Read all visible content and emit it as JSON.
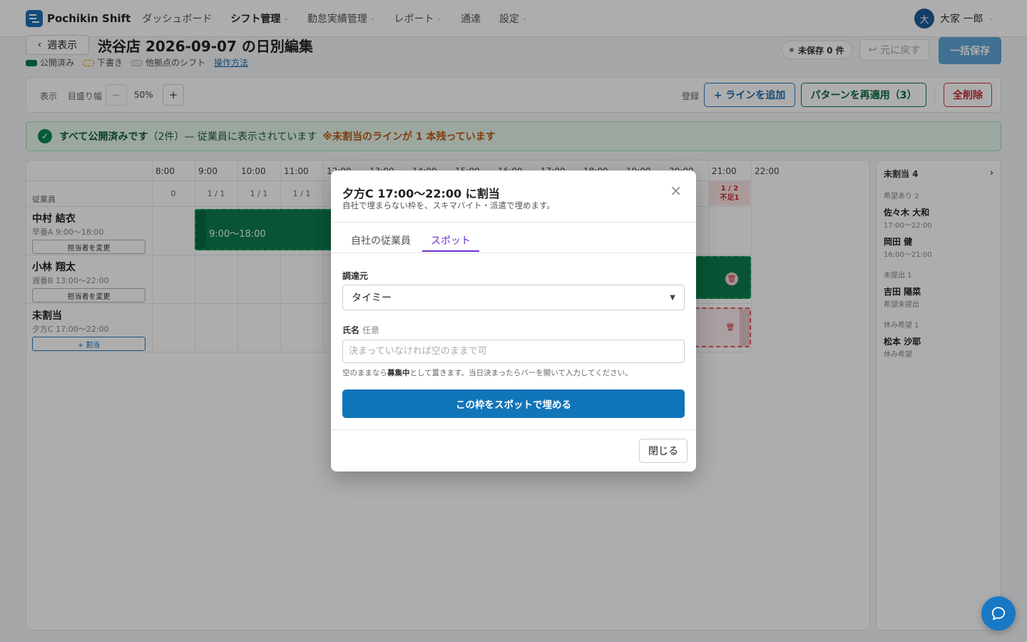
{
  "app": {
    "name": "Pochikin Shift"
  },
  "nav": {
    "items": [
      {
        "label": "ダッシュボード"
      },
      {
        "label": "シフト管理"
      },
      {
        "label": "勤怠実績管理"
      },
      {
        "label": "レポート"
      },
      {
        "label": "通達"
      },
      {
        "label": "設定"
      }
    ],
    "user": {
      "initial": "大",
      "name": "大家 一郎"
    }
  },
  "header": {
    "back_label": "週表示",
    "title": "渋谷店 2026-09-07 の日別編集",
    "legend": {
      "published": "公開済み",
      "draft": "下書き",
      "other_site": "他拠点のシフト",
      "help_link": "操作方法"
    },
    "unsaved": "未保存 0 件",
    "undo": "元に戻す",
    "save_all": "一括保存"
  },
  "toolbar": {
    "display_label": "表示",
    "scale_label": "目盛り幅",
    "minus": "−",
    "zoom": "50%",
    "plus": "+",
    "register_label": "登録",
    "add_line": "+ ラインを追加",
    "reapply": "パターンを再適用（3）",
    "delete_all": "全削除"
  },
  "banner": {
    "main": "すべて公開済みです",
    "count": "（2件）— 従業員に表示されています",
    "warning": "※未割当のラインが 1 本残っています"
  },
  "grid": {
    "column_header": "従業員",
    "hours": [
      "8:00",
      "9:00",
      "10:00",
      "11:00",
      "12:00",
      "13:00",
      "14:00",
      "15:00",
      "16:00",
      "17:00",
      "18:00",
      "19:00",
      "20:00",
      "21:00",
      "22:00"
    ],
    "counts": [
      "0",
      "1 / 1",
      "1 / 1",
      "1 / 1"
    ],
    "shortage": {
      "ratio": "1 / 2",
      "label": "不足1"
    },
    "rows": [
      {
        "name": "中村 結衣",
        "sub": "早番A 9:00〜18:00",
        "button": "担当者を変更"
      },
      {
        "name": "小林 翔太",
        "sub": "遅番B 13:00〜22:00",
        "button": "担当者を変更"
      },
      {
        "name": "未割当",
        "sub": "夕方C 17:00〜22:00",
        "button": "+ 割当"
      }
    ],
    "bar_label": "9:00〜18:00"
  },
  "panel": {
    "title": "未割当 4",
    "groups": [
      {
        "label": "希望あり 2",
        "people": [
          {
            "name": "佐々木 大和",
            "sub": "17:00〜22:00"
          },
          {
            "name": "岡田 健",
            "sub": "16:00〜21:00"
          }
        ]
      },
      {
        "label": "未提出 1",
        "people": [
          {
            "name": "吉田 陽菜",
            "sub": "希望未提出"
          }
        ]
      },
      {
        "label": "休み希望 1",
        "people": [
          {
            "name": "松本 沙耶",
            "sub": "休み希望"
          }
        ]
      }
    ]
  },
  "modal": {
    "title": "夕方C 17:00〜22:00 に割当",
    "subtitle": "自社で埋まらない枠を、スキマバイト・派遣で埋めます。",
    "tabs": [
      {
        "label": "自社の従業員"
      },
      {
        "label": "スポット"
      }
    ],
    "source_label": "調達元",
    "source_value": "タイミー",
    "name_label": "氏名",
    "name_optional": "任意",
    "name_placeholder": "決まっていなければ空のままで可",
    "help_prefix": "空のままなら",
    "help_bold": "募集中",
    "help_suffix": "として置きます。当日決まったらバーを開いて入力してください。",
    "submit": "この枠をスポットで埋める",
    "close": "閉じる"
  },
  "colors": {
    "brand": "#1b6fb5",
    "published": "#0c7c4d",
    "accent_tab": "#6b2fd0",
    "danger": "#c92a33"
  }
}
